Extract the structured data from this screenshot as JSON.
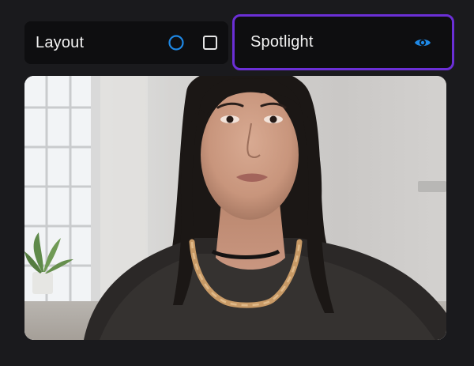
{
  "toolbar": {
    "layout": {
      "label": "Layout",
      "icons": [
        "circle-option-icon",
        "square-option-icon"
      ]
    },
    "spotlight": {
      "label": "Spotlight",
      "icon": "eye-icon",
      "selected": true
    }
  },
  "colors": {
    "background": "#1a1a1d",
    "pill": "#0e0e10",
    "accent": "#1e88e5",
    "selection_border": "#6b2fd6",
    "text": "#f2f2f2"
  },
  "video": {
    "subject": "participant-video"
  }
}
